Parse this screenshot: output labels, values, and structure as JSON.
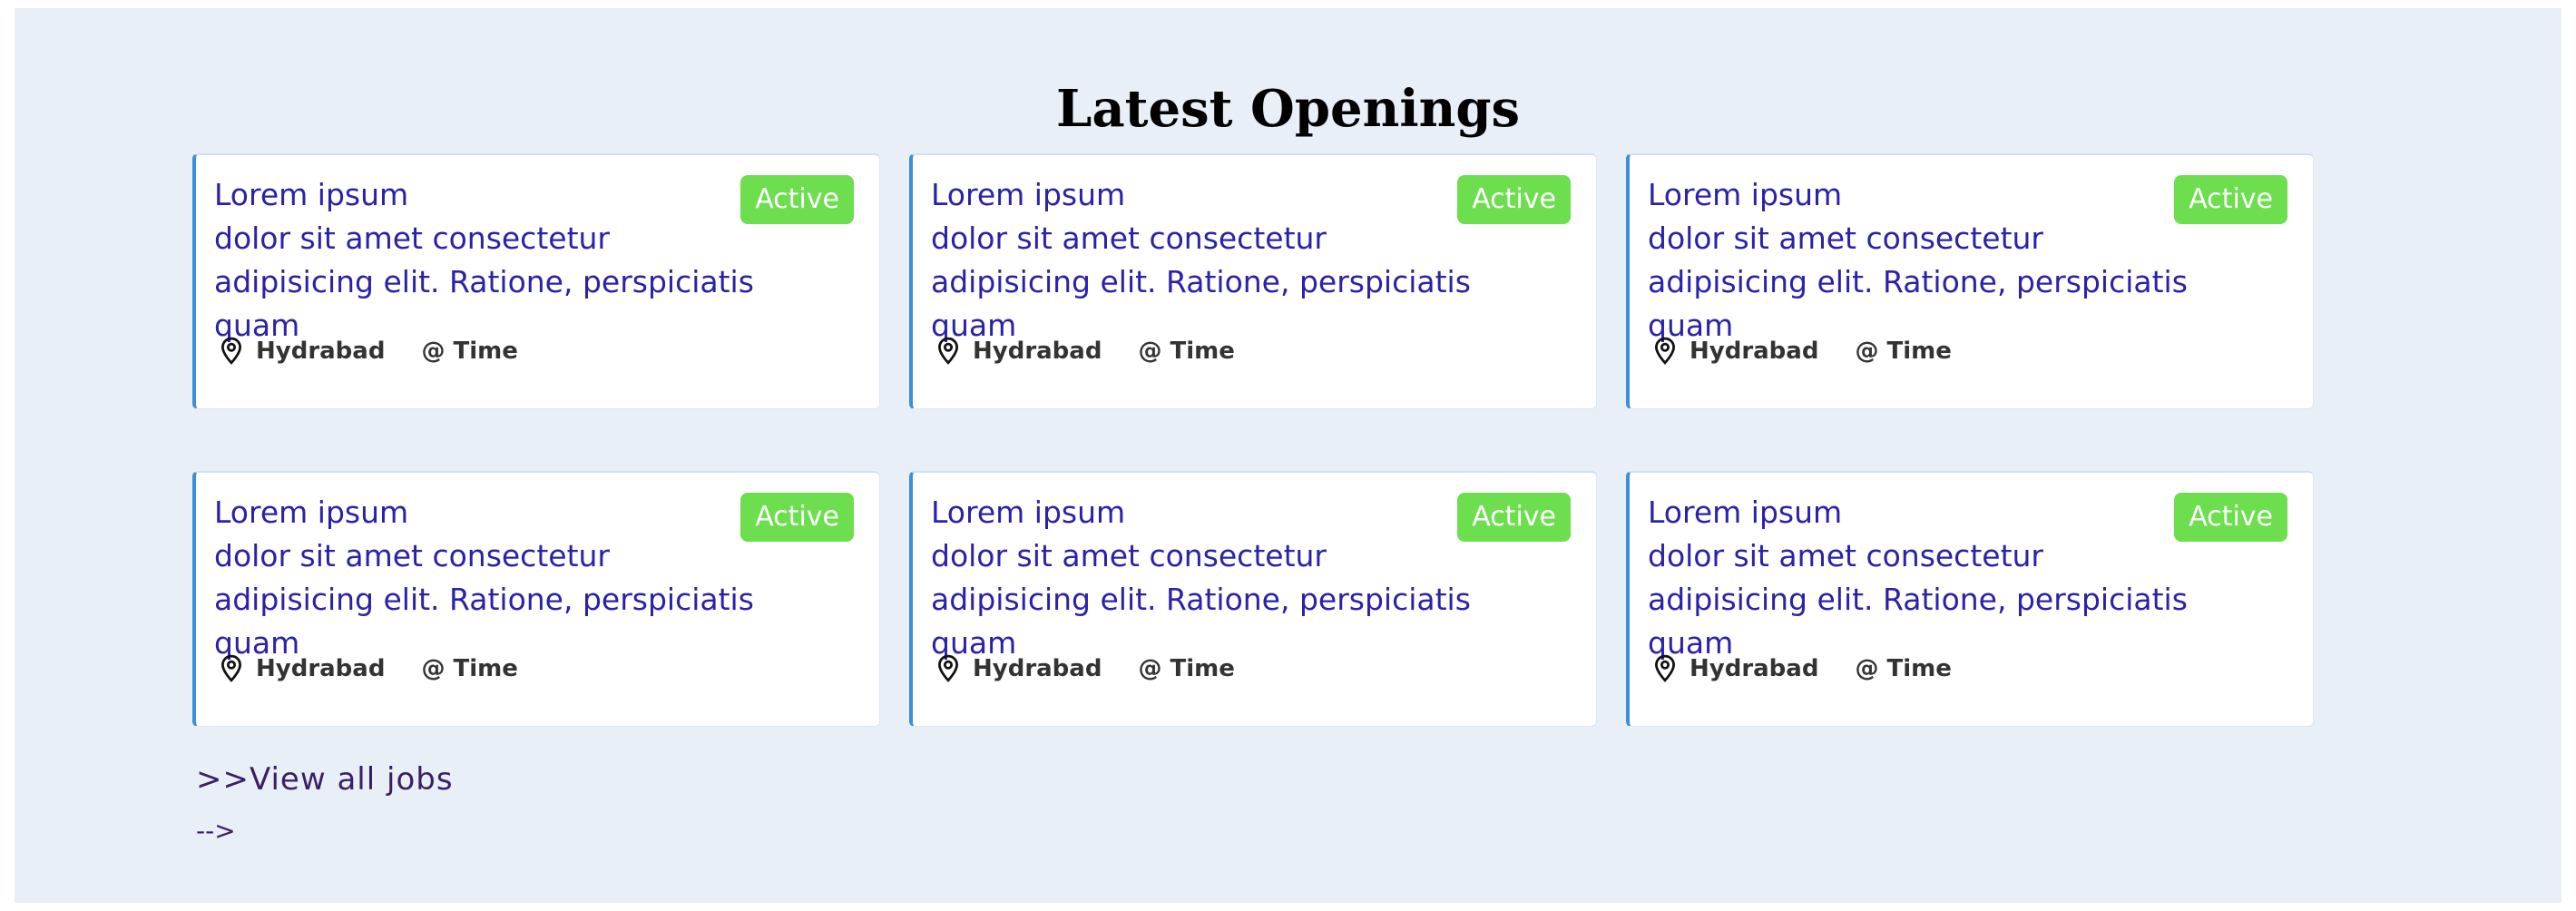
{
  "section": {
    "title": "Latest Openings"
  },
  "jobs": [
    {
      "title": "Lorem ipsum\ndolor sit amet consectetur\nadipisicing elit. Ratione, perspiciatis quam",
      "status": "Active",
      "location": "Hydrabad",
      "time": "@ Time"
    },
    {
      "title": "Lorem ipsum\ndolor sit amet consectetur\nadipisicing elit. Ratione, perspiciatis quam",
      "status": "Active",
      "location": "Hydrabad",
      "time": "@ Time"
    },
    {
      "title": "Lorem ipsum\ndolor sit amet consectetur\nadipisicing elit. Ratione, perspiciatis quam",
      "status": "Active",
      "location": "Hydrabad",
      "time": "@ Time"
    },
    {
      "title": "Lorem ipsum\ndolor sit amet consectetur\nadipisicing elit. Ratione, perspiciatis quam",
      "status": "Active",
      "location": "Hydrabad",
      "time": "@ Time"
    },
    {
      "title": "Lorem ipsum\ndolor sit amet consectetur\nadipisicing elit. Ratione, perspiciatis quam",
      "status": "Active",
      "location": "Hydrabad",
      "time": "@ Time"
    },
    {
      "title": "Lorem ipsum\ndolor sit amet consectetur\nadipisicing elit. Ratione, perspiciatis quam",
      "status": "Active",
      "location": "Hydrabad",
      "time": "@ Time"
    }
  ],
  "footer": {
    "view_all_label": ">>View all jobs",
    "comment_text": "-->"
  },
  "colors": {
    "background": "#e8eff7",
    "title_text": "#2a22a8",
    "badge": "#6ddf4f",
    "card_accent": "#3f8fd8",
    "link": "#3b1f66"
  },
  "icons": {
    "location": "map-pin-icon"
  }
}
